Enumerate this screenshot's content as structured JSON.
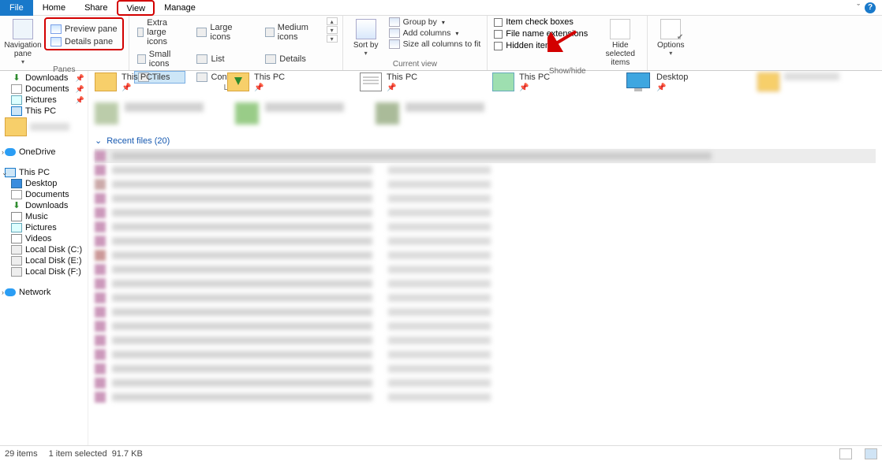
{
  "tabs": {
    "file": "File",
    "home": "Home",
    "share": "Share",
    "view": "View",
    "manage": "Manage"
  },
  "ribbon": {
    "nav_pane": "Navigation pane",
    "preview_pane": "Preview pane",
    "details_pane": "Details pane",
    "panes_label": "Panes",
    "layout": {
      "extra_large": "Extra large icons",
      "large": "Large icons",
      "medium": "Medium icons",
      "small": "Small icons",
      "list": "List",
      "details": "Details",
      "tiles": "Tiles",
      "content": "Content",
      "label": "Layout"
    },
    "current_view": {
      "sort_by": "Sort by",
      "group_by": "Group by",
      "add_columns": "Add columns",
      "size_cols": "Size all columns to fit",
      "label": "Current view"
    },
    "show_hide": {
      "check_boxes": "Item check boxes",
      "ext": "File name extensions",
      "hidden": "Hidden items",
      "hide_selected": "Hide selected items",
      "label": "Show/hide"
    },
    "options": "Options"
  },
  "sidebar": {
    "downloads": "Downloads",
    "documents": "Documents",
    "pictures": "Pictures",
    "this_pc": "This PC",
    "onedrive": "OneDrive",
    "root_this_pc": "This PC",
    "desktop": "Desktop",
    "sb_documents": "Documents",
    "sb_downloads": "Downloads",
    "music": "Music",
    "sb_pictures": "Pictures",
    "videos": "Videos",
    "disk_c": "Local Disk (C:)",
    "disk_e": "Local Disk (E:)",
    "disk_f": "Local Disk (F:)",
    "network": "Network"
  },
  "folders": [
    {
      "title": "This PC"
    },
    {
      "title": "This PC"
    },
    {
      "title": "This PC"
    },
    {
      "title": "This PC"
    },
    {
      "title": "Desktop"
    }
  ],
  "recent": {
    "label": "Recent files (20)",
    "count": 20
  },
  "status": {
    "items": "29 items",
    "selected": "1 item selected",
    "size": "91.7 KB"
  }
}
